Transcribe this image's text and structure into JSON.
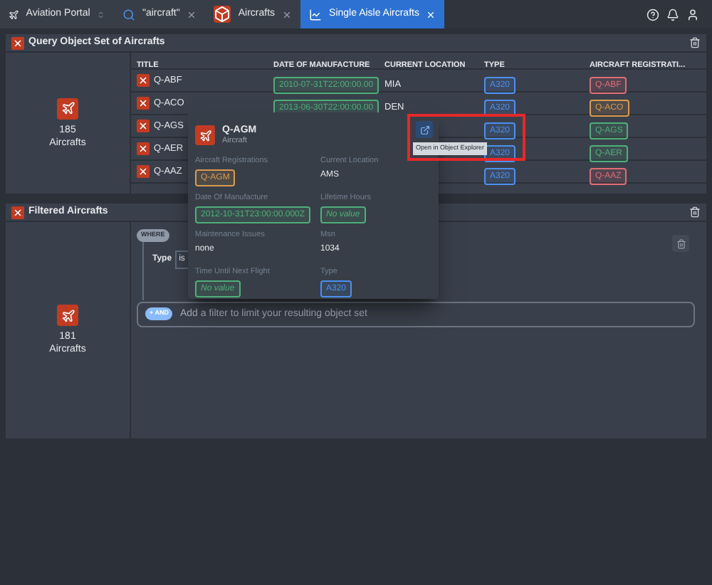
{
  "tabs": [
    {
      "kind": "home",
      "label": "Aviation Portal",
      "selected": false
    },
    {
      "kind": "search",
      "label": "\"aircraft\"",
      "selected": false
    },
    {
      "kind": "object",
      "label": "Aircrafts",
      "selected": false
    },
    {
      "kind": "chart",
      "label": "Single Aisle Aircrafts",
      "selected": true
    }
  ],
  "query_panel": {
    "title": "Query Object Set of Aircrafts",
    "count": "185",
    "count_label": "Aircrafts",
    "columns": [
      "TITLE",
      "DATE OF MANUFACTURE",
      "CURRENT LOCATION",
      "TYPE",
      "AIRCRAFT REGISTRATI..."
    ],
    "rows": [
      {
        "title": "Q-ABF",
        "date": "2010-07-31T22:00:00.00",
        "location": "MIA",
        "type": "A320",
        "registration": "Q-ABF",
        "color": "#e06c75"
      },
      {
        "title": "Q-ACO",
        "date": "2013-06-30T22:00:00.00",
        "location": "DEN",
        "type": "A320",
        "registration": "Q-ACO",
        "color": "#d99a4e"
      },
      {
        "title": "Q-AGS",
        "type": "A320",
        "registration": "Q-AGS",
        "color": "#4fae7a"
      },
      {
        "title": "Q-AER",
        "type": "A320",
        "registration": "Q-AER",
        "color": "#4fae7a"
      },
      {
        "title": "Q-AAZ",
        "type": "A320",
        "registration": "Q-AAZ",
        "color": "#e06c75"
      }
    ]
  },
  "filtered_panel": {
    "title": "Filtered Aircrafts",
    "count": "181",
    "count_label": "Aircrafts",
    "where": "WHERE",
    "filter_label": "Type",
    "filter_operator": "is",
    "and_button": "+ AND",
    "add_hint": "Add a filter to limit your resulting object set"
  },
  "popover": {
    "title": "Q-AGM",
    "subtitle": "Aircraft",
    "tooltip": "Open in Object Explorer",
    "fields": [
      {
        "label": "Aircraft Registrations",
        "kind": "tag",
        "value": "Q-AGM",
        "color": "#d99a4e"
      },
      {
        "label": "Current Location",
        "kind": "text",
        "value": "AMS"
      },
      {
        "label": "Date Of Manufacture",
        "kind": "tag",
        "value": "2012-10-31T23:00:00.000Z",
        "color": "#4fae7a"
      },
      {
        "label": "Lifetime Hours",
        "kind": "empty",
        "value": "No value",
        "color": "#4fae7a"
      },
      {
        "label": "Maintenance Issues",
        "kind": "text",
        "value": "none"
      },
      {
        "label": "Msn",
        "kind": "text",
        "value": "1034"
      },
      {
        "label": "Time Until Next Flight",
        "kind": "empty",
        "value": "No value",
        "color": "#4fae7a"
      },
      {
        "label": "Type",
        "kind": "tag",
        "value": "A320",
        "color": "#4c90f0"
      }
    ]
  }
}
